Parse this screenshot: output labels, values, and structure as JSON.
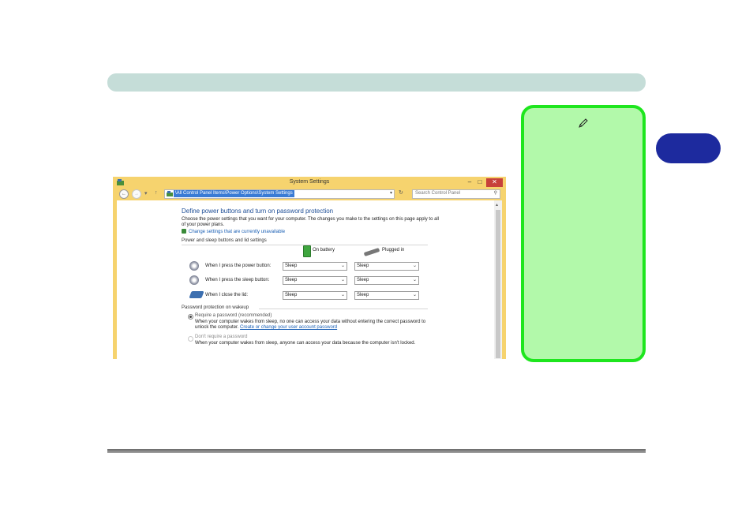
{
  "colors": {
    "header_bar": "#c5ddd8",
    "chapter_tab": "#1d2a9e",
    "note_fill": "#b2f9aa",
    "note_border": "#1ee61e",
    "window_frame": "#f6d36e",
    "heading_blue": "#1e4e96",
    "link_blue": "#1a5fb4"
  },
  "note": {
    "icon": "pencil-icon"
  },
  "window": {
    "title": "System Settings",
    "controls": {
      "minimize": "–",
      "maximize": "□",
      "close": "✕"
    },
    "address_path": "\\All Control Panel Items\\Power Options\\System Settings",
    "search_placeholder": "Search Control Panel",
    "heading": "Define power buttons and turn on password protection",
    "description": "Choose the power settings that you want for your computer. The changes you make to the settings on this page apply to all of your power plans.",
    "shield_link": "Change settings that are currently unavailable",
    "section_buttons": "Power and sleep buttons and lid settings",
    "col_battery": "On battery",
    "col_plugged": "Plugged in",
    "rows": [
      {
        "label": "When I press the power button:",
        "battery": "Sleep",
        "plugged": "Sleep"
      },
      {
        "label": "When I press the sleep button:",
        "battery": "Sleep",
        "plugged": "Sleep"
      },
      {
        "label": "When I close the lid:",
        "battery": "Sleep",
        "plugged": "Sleep"
      }
    ],
    "section_password": "Password protection on wakeup",
    "option_require": {
      "title": "Require a password (recommended)",
      "desc": "When your computer wakes from sleep, no one can access your data without entering the correct password to unlock the computer.",
      "link": "Create or change your user account password"
    },
    "option_dont": {
      "title": "Don't require a password",
      "desc": "When your computer wakes from sleep, anyone can access your data because the computer isn't locked."
    }
  }
}
